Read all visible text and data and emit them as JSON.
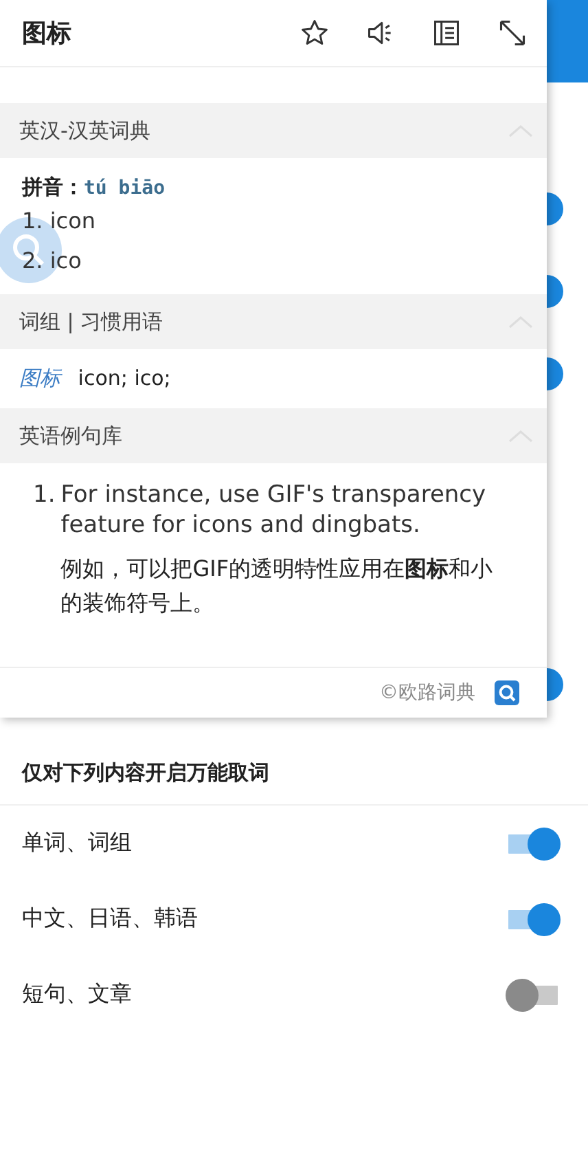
{
  "background_toggles": [
    {
      "on": true
    },
    {
      "on": true
    },
    {
      "on": true
    },
    {
      "on": true
    }
  ],
  "popup": {
    "title": "图标",
    "dictionary": {
      "header": "英汉-汉英词典",
      "expanded": true,
      "pinyin_label": "拼音：",
      "pinyin": "tú biāo",
      "meanings": [
        "1. icon",
        "2. ico"
      ]
    },
    "phrases": {
      "header": "词组 | 习惯用语",
      "expanded": true,
      "entries": [
        {
          "term": "图标",
          "definition": "icon; ico;"
        }
      ]
    },
    "examples": {
      "header": "英语例句库",
      "expanded": true,
      "items": [
        {
          "number": "1.",
          "english": "For instance, use GIF's transparency feature for icons and dingbats.",
          "chinese": "例如，可以把GIF的透明特性应用在**图标**和小的装饰符号上。"
        }
      ]
    },
    "footer": {
      "source": "©欧路词典"
    }
  },
  "settings": {
    "section_title": "仅对下列内容开启万能取词",
    "options": [
      {
        "label": "单词、词组",
        "on": true
      },
      {
        "label": "中文、日语、韩语",
        "on": true
      },
      {
        "label": "短句、文章",
        "on": false
      }
    ]
  }
}
